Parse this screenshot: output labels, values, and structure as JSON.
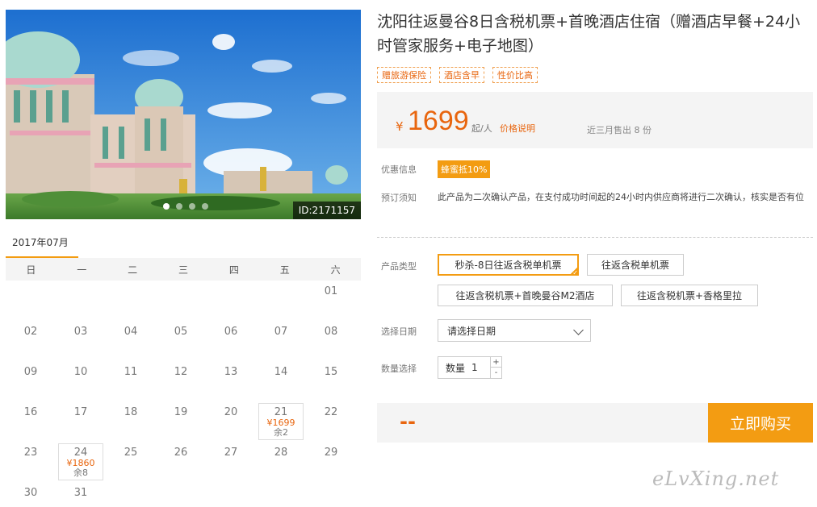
{
  "gallery": {
    "image_id": "ID:2171157",
    "dots": 4,
    "active_dot": 0
  },
  "calendar": {
    "month": "2017年07月",
    "weekdays": [
      "日",
      "一",
      "二",
      "三",
      "四",
      "五",
      "六"
    ],
    "leading_blanks": 6,
    "days": [
      {
        "d": "01"
      },
      {
        "d": "02"
      },
      {
        "d": "03"
      },
      {
        "d": "04"
      },
      {
        "d": "05"
      },
      {
        "d": "06"
      },
      {
        "d": "07"
      },
      {
        "d": "08"
      },
      {
        "d": "09"
      },
      {
        "d": "10"
      },
      {
        "d": "11"
      },
      {
        "d": "12"
      },
      {
        "d": "13"
      },
      {
        "d": "14"
      },
      {
        "d": "15"
      },
      {
        "d": "16"
      },
      {
        "d": "17"
      },
      {
        "d": "18"
      },
      {
        "d": "19"
      },
      {
        "d": "20"
      },
      {
        "d": "21",
        "price": "¥1699",
        "remain": "余2"
      },
      {
        "d": "22"
      },
      {
        "d": "23"
      },
      {
        "d": "24",
        "price": "¥1860",
        "remain": "余8"
      },
      {
        "d": "25"
      },
      {
        "d": "26"
      },
      {
        "d": "27"
      },
      {
        "d": "28"
      },
      {
        "d": "29"
      },
      {
        "d": "30"
      },
      {
        "d": "31"
      }
    ]
  },
  "product": {
    "title": "沈阳往返曼谷8日含税机票+首晚酒店住宿（赠酒店早餐+24小时管家服务+电子地图）",
    "tags": [
      "赠旅游保险",
      "酒店含早",
      "性价比高"
    ]
  },
  "price": {
    "currency": "¥",
    "amount": "1699",
    "per": "起/人",
    "explain": "价格说明",
    "sold": "近三月售出 8 份"
  },
  "info": {
    "promo_label": "优惠信息",
    "promo_badge": "蜂蜜抵10%",
    "notice_label": "预订须知",
    "notice_text": "此产品为二次确认产品，在支付成功时间起的24小时内供应商将进行二次确认，核实是否有位"
  },
  "options": {
    "type_label": "产品类型",
    "types": [
      "秒杀-8日往返含税单机票",
      "往返含税单机票",
      "往返含税机票+首晚曼谷M2酒店",
      "往返含税机票+香格里拉"
    ],
    "selected_index": 0,
    "date_label": "选择日期",
    "date_placeholder": "请选择日期",
    "qty_label": "数量选择",
    "qty_prefix": "数量",
    "qty_value": "1",
    "plus": "+",
    "minus": "-"
  },
  "buy": {
    "total": "--",
    "button": "立即购买"
  },
  "watermark": "eLvXing.net",
  "colors": {
    "accent": "#f39c12",
    "price": "#e8650e"
  }
}
